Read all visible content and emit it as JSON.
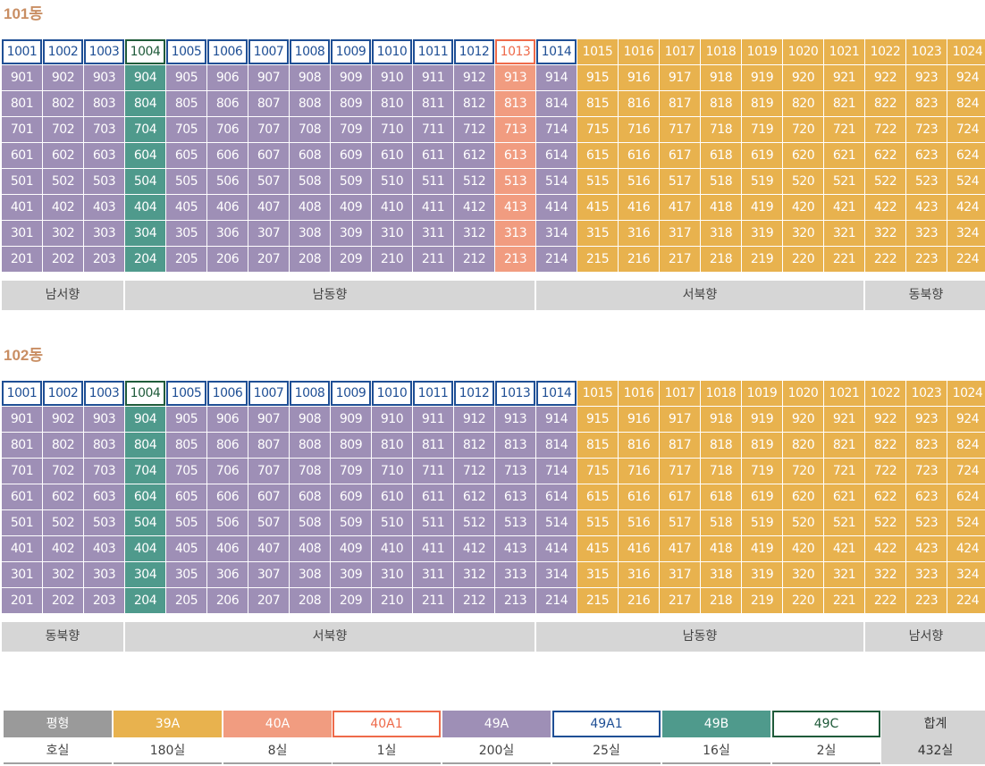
{
  "buildings": [
    {
      "title": "101동",
      "floors": [
        10,
        9,
        8,
        7,
        6,
        5,
        4,
        3,
        2
      ],
      "units_per_floor": 24,
      "type_rules": {
        "default_low": "39A",
        "ranges": [
          {
            "from": 1,
            "to": 14,
            "top_floor": "49A1",
            "other_floors": "49A"
          },
          {
            "from": 15,
            "to": 24,
            "top_floor": "39A",
            "other_floors": "39A"
          }
        ],
        "overrides": [
          {
            "unit": 4,
            "top_floor": "49C",
            "other_floors": "49B"
          },
          {
            "unit": 13,
            "top_floor": "40A1",
            "other_floors": "40A"
          }
        ]
      },
      "directions": [
        {
          "label": "남서향",
          "from": 1,
          "to": 3
        },
        {
          "label": "남동향",
          "from": 4,
          "to": 13
        },
        {
          "label": "서북향",
          "from": 14,
          "to": 21
        },
        {
          "label": "동북향",
          "from": 22,
          "to": 24
        }
      ]
    },
    {
      "title": "102동",
      "floors": [
        10,
        9,
        8,
        7,
        6,
        5,
        4,
        3,
        2
      ],
      "units_per_floor": 24,
      "type_rules": {
        "ranges": [
          {
            "from": 1,
            "to": 14,
            "top_floor": "49A1",
            "other_floors": "49A"
          },
          {
            "from": 15,
            "to": 24,
            "top_floor": "39A",
            "other_floors": "39A"
          }
        ],
        "overrides": [
          {
            "unit": 4,
            "top_floor": "49C",
            "other_floors": "49B"
          }
        ]
      },
      "directions": [
        {
          "label": "동북향",
          "from": 1,
          "to": 3
        },
        {
          "label": "서북향",
          "from": 4,
          "to": 13
        },
        {
          "label": "남동향",
          "from": 14,
          "to": 21
        },
        {
          "label": "남서향",
          "from": 22,
          "to": 24
        }
      ]
    }
  ],
  "legend": {
    "header_label": "평형",
    "count_label": "호실",
    "total_label": "합계",
    "total_value": "432실",
    "types": [
      {
        "code": "39A",
        "count": "180실",
        "style": "39a"
      },
      {
        "code": "40A",
        "count": "8실",
        "style": "40a"
      },
      {
        "code": "40A1",
        "count": "1실",
        "style": "40a1"
      },
      {
        "code": "49A",
        "count": "200실",
        "style": "49a"
      },
      {
        "code": "49A1",
        "count": "25실",
        "style": "49a1"
      },
      {
        "code": "49B",
        "count": "16실",
        "style": "49b"
      },
      {
        "code": "49C",
        "count": "2실",
        "style": "49c"
      }
    ]
  },
  "colors": {
    "39A": "#e8b24e",
    "40A": "#f19c80",
    "40A1": "#ee6a4a",
    "49A": "#9e8fb6",
    "49A1": "#1f4f95",
    "49B": "#4f9a8c",
    "49C": "#1f5b3a",
    "title": "#c98e63"
  }
}
